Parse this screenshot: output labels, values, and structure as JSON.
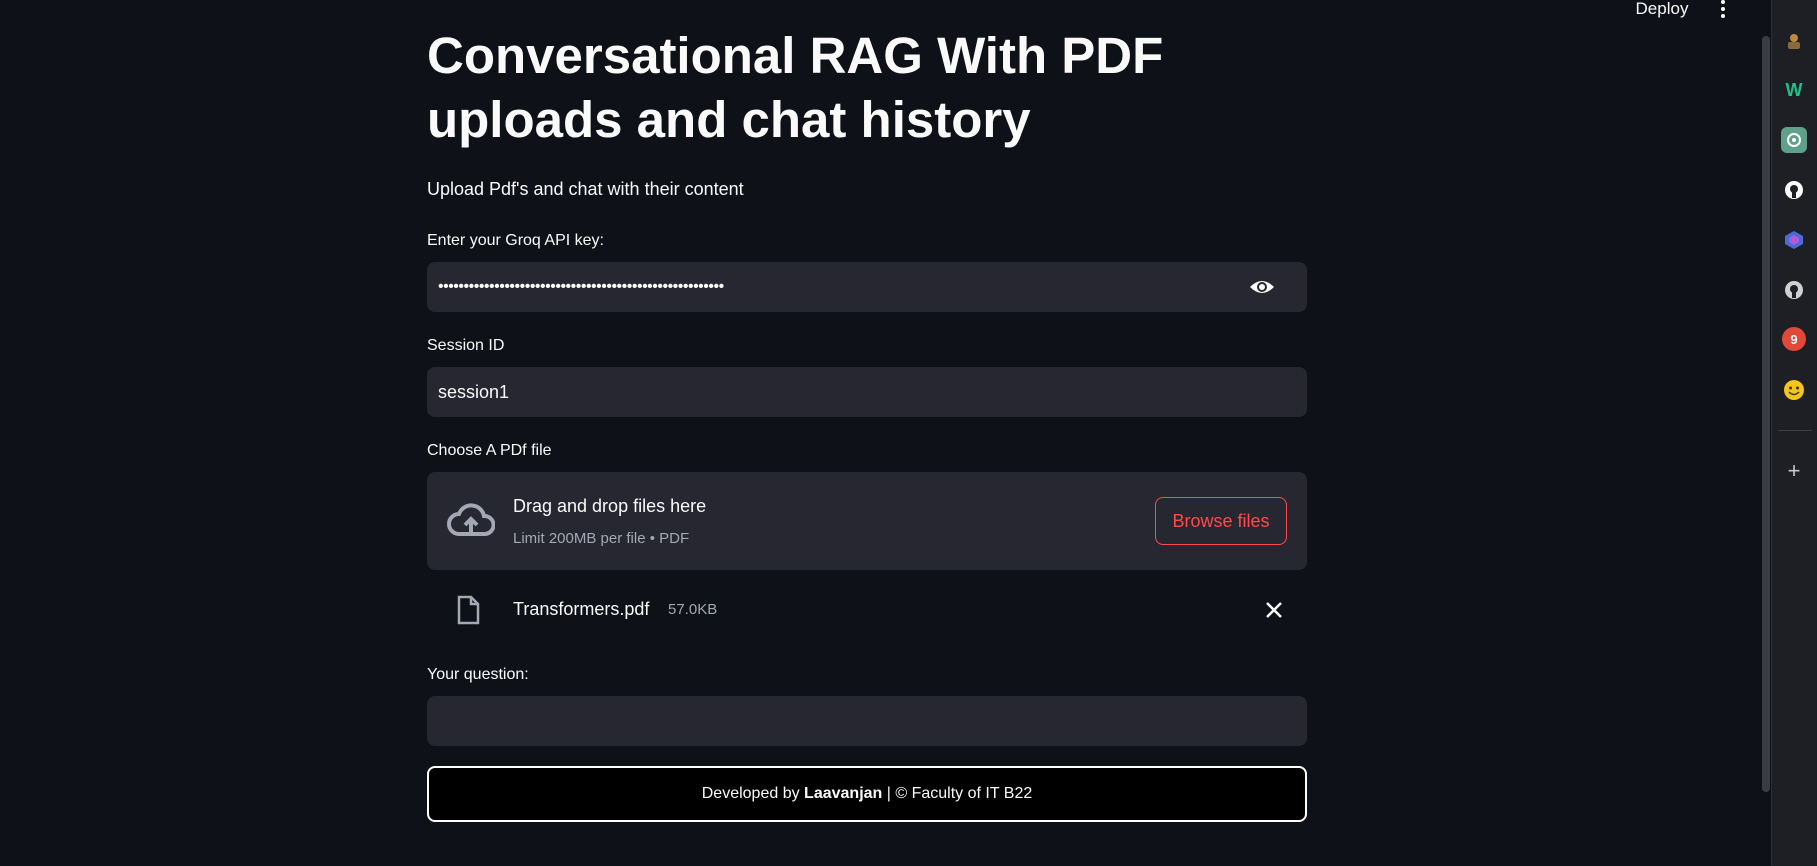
{
  "header": {
    "deploy_label": "Deploy"
  },
  "page": {
    "title": "Conversational RAG With PDF uploads and chat history",
    "subtitle": "Upload Pdf's and chat with their content"
  },
  "api_key": {
    "label": "Enter your Groq API key:",
    "masked_value": "••••••••••••••••••••••••••••••••••••••••••••••••••••••••"
  },
  "session": {
    "label": "Session ID",
    "value": "session1"
  },
  "uploader": {
    "label": "Choose A PDf file",
    "drop_text": "Drag and drop files here",
    "limit_text": "Limit 200MB per file • PDF",
    "browse_label": "Browse files",
    "accent": "#ff4b4b"
  },
  "uploaded_file": {
    "name": "Transformers.pdf",
    "size": "57.0KB"
  },
  "question": {
    "label": "Your question:",
    "value": ""
  },
  "footer": {
    "prefix": "Developed by",
    "author": "Laavanjan",
    "suffix": "| © Faculty of IT B22"
  },
  "sidepanel": {
    "icons": [
      "extension-icon",
      "w-logo-icon",
      "chatgpt-icon",
      "github-icon",
      "copilot-icon",
      "github-icon",
      "notification-icon",
      "hugging-face-icon",
      "add-icon"
    ],
    "notification_count": "9"
  }
}
